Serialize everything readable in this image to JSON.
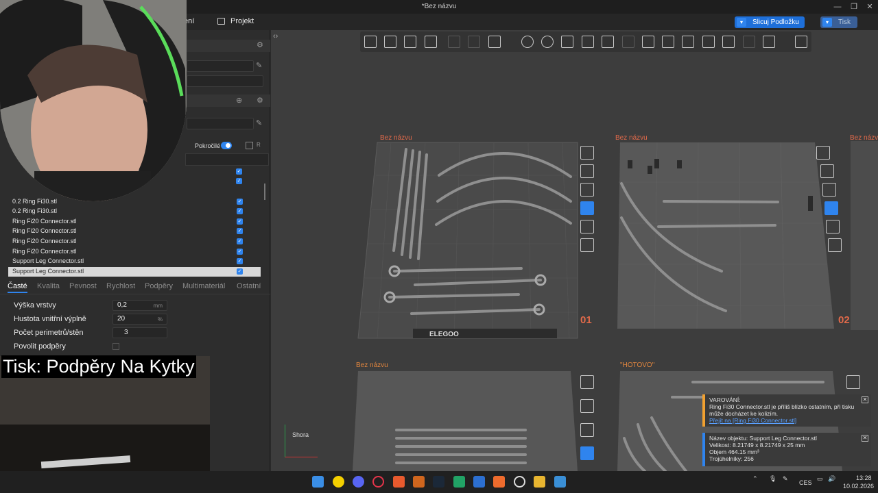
{
  "window": {
    "title": "*Bez názvu"
  },
  "menubar": {
    "partial_item": "ení",
    "project_label": "Projekt",
    "slice_button": "Slicuj Podložku",
    "print_button": "Tisk"
  },
  "sidebar": {
    "advanced_label": "Pokročilé",
    "objects": [
      "0.2 Ring Fi30.stl",
      "0.2 Ring Fi30.stl",
      "Ring Fi20 Connector.stl",
      "Ring Fi20 Connector.stl",
      "Ring Fi20 Connector.stl",
      "Ring Fi20 Connector.stl",
      "Support Leg Connector.stl",
      "Support Leg Connector.stl"
    ],
    "tabs": [
      "Časté",
      "Kvalita",
      "Pevnost",
      "Rychlost",
      "Podpěry",
      "Multimateriál",
      "Ostatní"
    ],
    "params": [
      {
        "label": "Výška vrstvy",
        "value": "0,2",
        "unit": "mm"
      },
      {
        "label": "Hustota vnitřní výplně",
        "value": "20",
        "unit": "%"
      },
      {
        "label": "Počet perimetrů/stěn",
        "value": "3",
        "unit": ""
      },
      {
        "label": "Povolit podpěry",
        "value": "",
        "unit": ""
      }
    ]
  },
  "plates": [
    {
      "title": "Bez názvu",
      "number": "01"
    },
    {
      "title": "Bez názvu",
      "number": "02"
    },
    {
      "title": "Bez názvu",
      "number": ""
    },
    {
      "title": "Bez názvu",
      "number": ""
    },
    {
      "title": "\"HOTOVO\"",
      "number": ""
    }
  ],
  "plate1_brand": "ELEGOO",
  "view_cube_label": "Shora",
  "notices": {
    "warning_title": "VAROVÁNÍ:",
    "warning_text": "Ring Fi30 Connector.stl je příliš blízko ostatním, při tisku může docházet ke kolizím.",
    "warning_link": "Přejít na [Ring Fi30 Connector.stl]",
    "info_name": "Název objektu: Support Leg Connector.stl",
    "info_size": "Velikost: 8.21749 x 8.21749 x 25 mm",
    "info_volume": "Objem 464.15 mm³",
    "info_triangles": "Trojúhelníky: 256"
  },
  "overlay_title": "Tisk: Podpěry Na Kytky",
  "taskbar": {
    "lang": "CES",
    "time": "13:28",
    "date": "10.02.2026"
  },
  "colors": {
    "accent": "#2f84ee",
    "plate_label": "#e26a4a",
    "warning": "#f0a030"
  }
}
